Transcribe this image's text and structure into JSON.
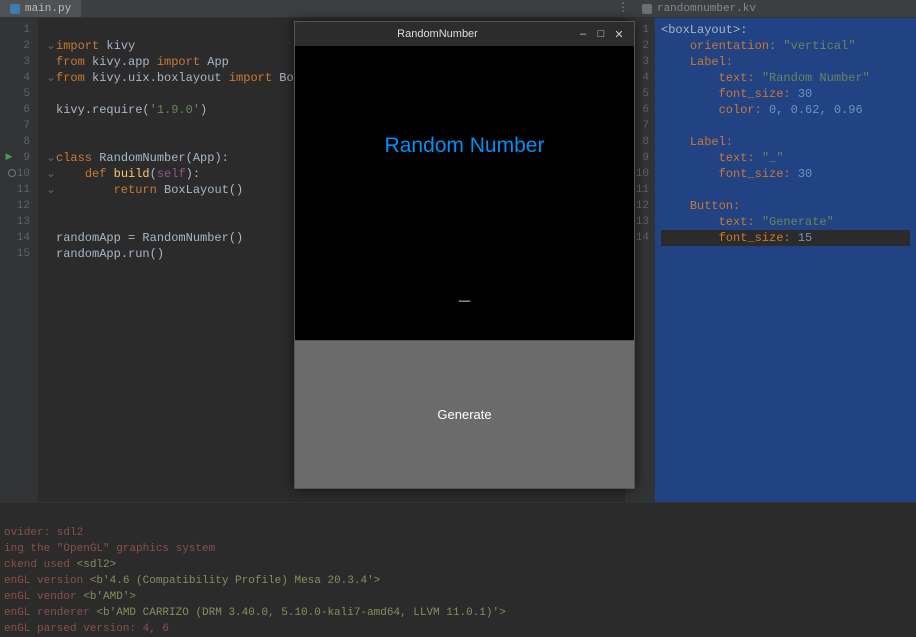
{
  "tabs": {
    "left": "main.py",
    "right": "randomnumber.kv",
    "kebab": "⋮"
  },
  "left_editor": {
    "lines": {
      "1": {
        "n": "1"
      },
      "2": {
        "n": "2"
      },
      "3": {
        "n": "3"
      },
      "4": {
        "n": "4"
      },
      "5": {
        "n": "5"
      },
      "6": {
        "n": "6"
      },
      "7": {
        "n": "7"
      },
      "8": {
        "n": "8"
      },
      "9": {
        "n": "9"
      },
      "10": {
        "n": "10"
      },
      "11": {
        "n": "11"
      },
      "12": {
        "n": "12"
      },
      "13": {
        "n": "13"
      },
      "14": {
        "n": "14"
      },
      "15": {
        "n": "15"
      }
    },
    "tok": {
      "import": "import",
      "from": "from",
      "class": "class",
      "def": "def",
      "return": "return",
      "kivy": "kivy",
      "kivy_app": "kivy.app",
      "App": "App",
      "kivy_uix_boxlayout": "kivy.uix.boxlayout",
      "BoxLayout": "BoxLayout",
      "require": ".require(",
      "ver": "'1.9.0'",
      "close": ")",
      "RandomNumber": "RandomNumber",
      "AppParen": "(App):",
      "build": "build",
      "self": "self",
      "parenclose": "):",
      "BoxLayoutCall": "BoxLayout()",
      "randomApp": "randomApp",
      "eq": " = ",
      "RandomNumberCall": "RandomNumber()",
      "dotrun": ".run()"
    }
  },
  "right_editor": {
    "lines": {
      "1": {
        "n": "1"
      },
      "2": {
        "n": "2"
      },
      "3": {
        "n": "3"
      },
      "4": {
        "n": "4"
      },
      "5": {
        "n": "5"
      },
      "6": {
        "n": "6"
      },
      "7": {
        "n": "7"
      },
      "8": {
        "n": "8"
      },
      "9": {
        "n": "9"
      },
      "10": {
        "n": "10"
      },
      "11": {
        "n": "11"
      },
      "12": {
        "n": "12"
      },
      "13": {
        "n": "13"
      },
      "14": {
        "n": "14"
      }
    },
    "tok": {
      "boxLayout": "<boxLayout>:",
      "orientation": "orientation:",
      "vertical": " \"vertical\"",
      "Label": "Label:",
      "text": "text:",
      "randomNumber": " \"Random Number\"",
      "font_size": "font_size:",
      "thirty": " 30",
      "color": "color:",
      "colorval": " 0, 0.62, 0.96",
      "underscore": " \"_\"",
      "Button": "Button:",
      "generate": " \"Generate\"",
      "fifteen": " 15"
    }
  },
  "app_window": {
    "title": "RandomNumber",
    "minimize": "–",
    "maximize": "□",
    "close": "✕",
    "label_top": "Random Number",
    "label_mid": "_",
    "button": "Generate"
  },
  "terminal": {
    "l1a": "ovider: sdl2",
    "l2a": "ing the \"OpenGL\" graphics system",
    "l3a": "ckend used ",
    "l3b": "<sdl2>",
    "l4a": "enGL version ",
    "l4b": "<b'4.6 (Compatibility Profile) Mesa 20.3.4'>",
    "l5a": "enGL vendor ",
    "l5b": "<b'AMD'>",
    "l6a": "enGL renderer ",
    "l6b": "<b'AMD CARRIZO (DRM 3.40.0, 5.10.0-kali7-amd64, LLVM 11.0.1)'>",
    "l7a": "enGL parsed version: 4, 6"
  }
}
